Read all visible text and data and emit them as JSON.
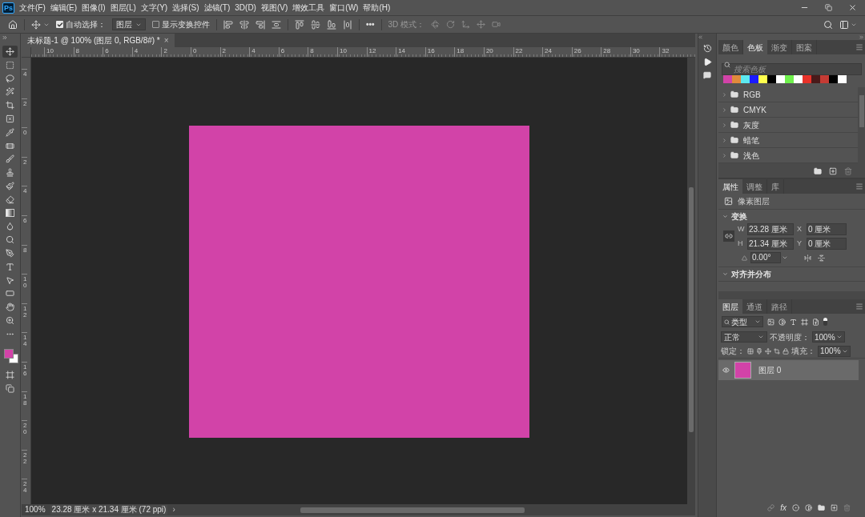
{
  "menu": [
    "文件(F)",
    "编辑(E)",
    "图像(I)",
    "图层(L)",
    "文字(Y)",
    "选择(S)",
    "滤镜(T)",
    "3D(D)",
    "视图(V)",
    "增效工具",
    "窗口(W)",
    "帮助(H)"
  ],
  "app_logo": "Ps",
  "options_bar": {
    "auto_select": {
      "label": "自动选择：",
      "checked": true
    },
    "target": "图层",
    "show_transform": {
      "label": "显示变换控件",
      "checked": false
    },
    "more": "•••",
    "mode_3d": {
      "label": "3D 模式：",
      "disabled": true
    }
  },
  "document_tab": {
    "title": "未标题-1 @ 100% (图层 0, RGB/8#) *",
    "close": "×",
    "selected": true
  },
  "ruler_h": [
    "10",
    "8",
    "6",
    "4",
    "2",
    "0",
    "2",
    "4",
    "6",
    "8",
    "10",
    "12",
    "14",
    "16",
    "18",
    "20",
    "22",
    "24",
    "26",
    "28",
    "30",
    "32"
  ],
  "ruler_v": [
    "4",
    "2",
    "0",
    "2",
    "4",
    "6",
    "8",
    "10",
    "12",
    "14",
    "16",
    "18",
    "20",
    "22",
    "24"
  ],
  "tools": [
    {
      "kind": "move",
      "selected": true
    },
    {
      "kind": "marquee",
      "selected": false
    },
    {
      "kind": "lasso",
      "selected": false
    },
    {
      "kind": "wand",
      "selected": false
    },
    {
      "kind": "crop",
      "selected": false
    },
    {
      "kind": "frame",
      "selected": false
    },
    {
      "kind": "eyedropper",
      "selected": false
    },
    {
      "kind": "healing",
      "selected": false
    },
    {
      "kind": "brush",
      "selected": false
    },
    {
      "kind": "stamp",
      "selected": false
    },
    {
      "kind": "history_brush",
      "selected": false
    },
    {
      "kind": "eraser",
      "selected": false
    },
    {
      "kind": "gradient",
      "selected": false
    },
    {
      "kind": "blur",
      "selected": false
    },
    {
      "kind": "dodge",
      "selected": false
    },
    {
      "kind": "pen",
      "selected": false
    },
    {
      "kind": "type",
      "selected": false
    },
    {
      "kind": "path_select",
      "selected": false
    },
    {
      "kind": "shape",
      "selected": false
    },
    {
      "kind": "hand",
      "selected": false
    },
    {
      "kind": "zoom",
      "selected": false
    },
    {
      "kind": "more",
      "selected": false
    }
  ],
  "colors": [
    {
      "kind": "foreground",
      "color": "#d243a8"
    },
    {
      "kind": "background",
      "color": "#ffffff"
    }
  ],
  "status": {
    "zoom": "100%",
    "info": "23.28 厘米 x 21.34 厘米 (72 ppi)",
    "arrow": "›"
  },
  "swatches_panel": {
    "tabs": [
      {
        "label": "颜色",
        "selected": false
      },
      {
        "label": "色板",
        "selected": true
      },
      {
        "label": "渐变",
        "selected": false
      },
      {
        "label": "图案",
        "selected": false
      }
    ],
    "search_placeholder": "搜索色板",
    "swatches": [
      {
        "color": "#d243a8"
      },
      {
        "color": "#e08a3c"
      },
      {
        "color": "#5ce9f0"
      },
      {
        "color": "#1a1aff"
      },
      {
        "color": "#ffff4d"
      },
      {
        "color": "#000000"
      },
      {
        "color": "#ffffff"
      },
      {
        "color": "#6ef04b"
      },
      {
        "color": "#ffffff"
      },
      {
        "color": "#e8322a"
      },
      {
        "color": "#4a1a1a"
      },
      {
        "color": "#c43b34"
      },
      {
        "color": "#000000"
      },
      {
        "color": "#ffffff"
      }
    ],
    "groups": [
      {
        "label": "RGB",
        "expanded": false
      },
      {
        "label": "CMYK",
        "expanded": false
      },
      {
        "label": "灰度",
        "expanded": false
      },
      {
        "label": "蜡笔",
        "expanded": false
      },
      {
        "label": "浅色",
        "expanded": false
      }
    ]
  },
  "properties_panel": {
    "tabs": [
      {
        "label": "属性",
        "selected": true
      },
      {
        "label": "调整",
        "selected": false
      },
      {
        "label": "库",
        "selected": false
      }
    ],
    "layer_type": "像素图层",
    "sections": [
      {
        "title": "变换",
        "expanded": true
      },
      {
        "title": "对齐并分布",
        "expanded": true
      }
    ],
    "fields": [
      {
        "label": "W",
        "value": "23.28 厘米"
      },
      {
        "label": "X",
        "value": "0 厘米"
      },
      {
        "label": "H",
        "value": "21.34 厘米"
      },
      {
        "label": "Y",
        "value": "0 厘米"
      }
    ],
    "angle": "0.00°"
  },
  "layers_panel": {
    "tabs": [
      {
        "label": "图层",
        "selected": true
      },
      {
        "label": "通道",
        "selected": false
      },
      {
        "label": "路径",
        "selected": false
      }
    ],
    "filter": "类型",
    "blend_mode": "正常",
    "opacity_label": "不透明度：",
    "opacity": "100%",
    "lock_label": "锁定：",
    "fill_label": "填充：",
    "fill": "100%",
    "fx": "fx",
    "layers": [
      {
        "name": "图层 0",
        "visible": true,
        "selected": true,
        "color": "#d243a8"
      }
    ]
  }
}
